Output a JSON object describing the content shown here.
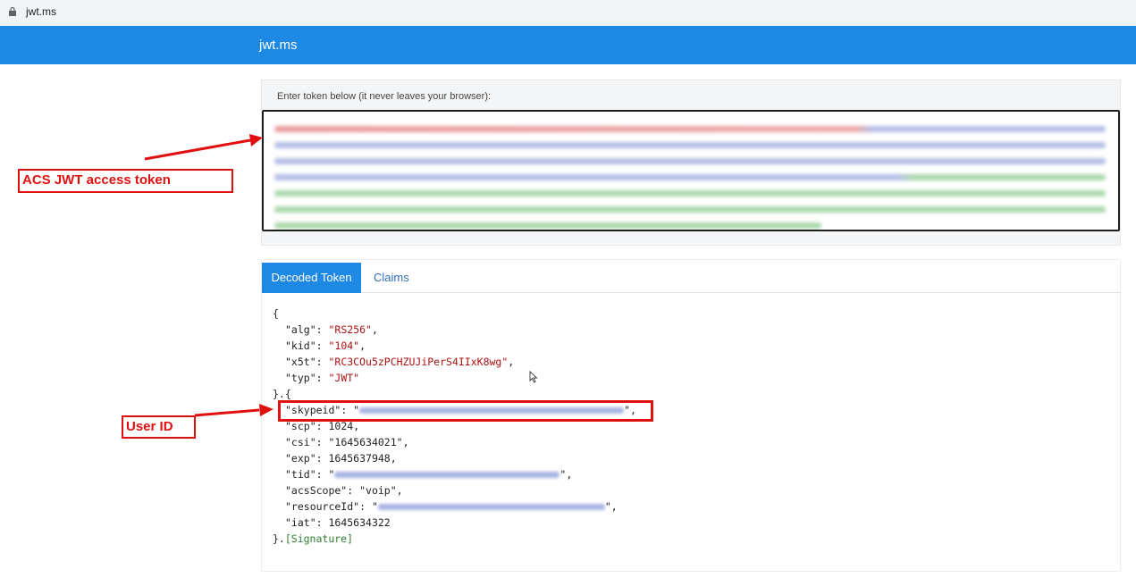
{
  "browser": {
    "url": "jwt.ms"
  },
  "header": {
    "title": "jwt.ms"
  },
  "token_card": {
    "prompt": "Enter token below (it never leaves your browser):"
  },
  "tabs": [
    {
      "label": "Decoded Token"
    },
    {
      "label": "Claims"
    }
  ],
  "decoded": {
    "open_brace": "{",
    "alg_key": "\"alg\"",
    "alg_val": "\"RS256\"",
    "kid_key": "\"kid\"",
    "kid_val": "\"104\"",
    "x5t_key": "\"x5t\"",
    "x5t_val": "\"RC3COu5zPCHZUJiPerS4IIxK8wg\"",
    "typ_key": "\"typ\"",
    "typ_val": "\"JWT\"",
    "sep": "}.{",
    "skypeid_key": "\"skypeid\"",
    "scp_key": "\"scp\"",
    "scp_val": "1024",
    "csi_key": "\"csi\"",
    "csi_val": "\"1645634021\"",
    "exp_key": "\"exp\"",
    "exp_val": "1645637948",
    "tid_key": "\"tid\"",
    "acsScope_key": "\"acsScope\"",
    "acsScope_val": "\"voip\"",
    "resourceId_key": "\"resourceId\"",
    "iat_key": "\"iat\"",
    "iat_val": "1645634322",
    "close": "}.",
    "signature": "[Signature]"
  },
  "annotations": {
    "token_label": "ACS JWT access token",
    "userid_label": "User ID"
  },
  "colors": {
    "header_bg": "#1e88e5",
    "annotation": "#e01010"
  }
}
